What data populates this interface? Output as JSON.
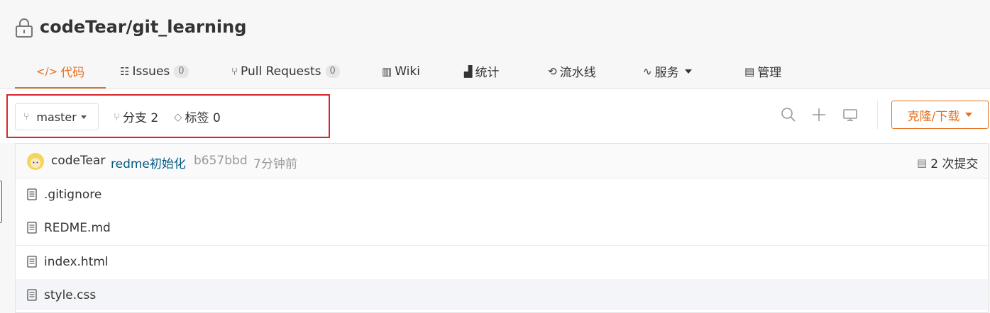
{
  "repo": {
    "title": "codeTear/git_learning"
  },
  "tabs": [
    {
      "label": "代码",
      "icon": "code-icon",
      "active": true
    },
    {
      "label": "Issues",
      "icon": "issues-icon",
      "count": "0"
    },
    {
      "label": "Pull Requests",
      "icon": "pull-request-icon",
      "count": "0"
    },
    {
      "label": "Wiki",
      "icon": "book-icon"
    },
    {
      "label": "统计",
      "icon": "stats-icon"
    },
    {
      "label": "流水线",
      "icon": "pipeline-icon"
    },
    {
      "label": "服务",
      "icon": "pulse-icon",
      "dropdown": true
    },
    {
      "label": "管理",
      "icon": "manage-icon"
    }
  ],
  "toolbar": {
    "branch": "master",
    "branches_label": "分支 2",
    "tags_label": "标签 0",
    "clone_label": "克隆/下载"
  },
  "commit": {
    "author": "codeTear",
    "message": "redme初始化",
    "hash": "b657bbd",
    "time": "7分钟前",
    "count_label": "2 次提交"
  },
  "files": [
    {
      "name": ".gitignore"
    },
    {
      "name": "REDME.md"
    },
    {
      "name": "index.html"
    },
    {
      "name": "style.css"
    }
  ],
  "colors": {
    "accent": "#e5701e",
    "highlight": "#d9252b",
    "link": "#005980"
  }
}
